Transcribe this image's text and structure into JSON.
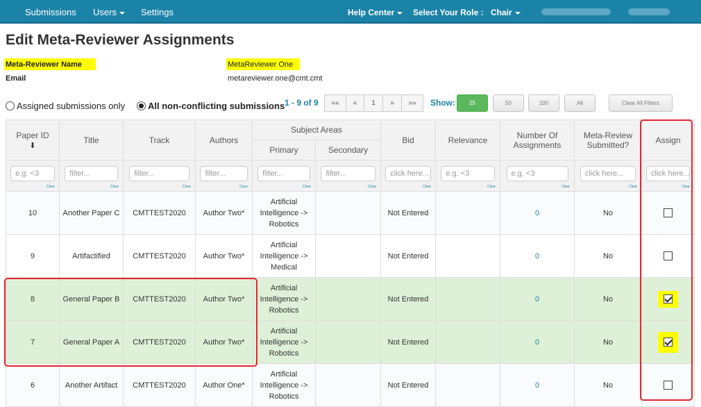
{
  "nav": {
    "submissions": "Submissions",
    "users": "Users",
    "settings": "Settings",
    "help_center": "Help Center",
    "role_label": "Select Your Role :",
    "role_value": "Chair"
  },
  "page": {
    "title": "Edit Meta-Reviewer Assignments",
    "name_label": "Meta-Reviewer Name",
    "name_value": "MetaReviewer One",
    "email_label": "Email",
    "email_value": "metareviewer.one@cmt.cmt"
  },
  "controls": {
    "radio_assigned": "Assigned submissions only",
    "radio_nonconflicting": "All non-conflicting submissions",
    "range": "1 - 9 of 9",
    "pager": [
      "««",
      "«",
      "1",
      "»",
      "»»"
    ],
    "show_label": "Show:",
    "show_options": [
      "25",
      "50",
      "100",
      "All"
    ],
    "clear_filters": "Clear All Filters"
  },
  "table": {
    "headers": {
      "paper_id": "Paper ID",
      "sort_arrow": "⬇",
      "title": "Title",
      "track": "Track",
      "authors": "Authors",
      "subject_areas": "Subject Areas",
      "primary": "Primary",
      "secondary": "Secondary",
      "bid": "Bid",
      "relevance": "Relevance",
      "num_assignments": "Number Of Assignments",
      "meta_review_submitted": "Meta-Review Submitted?",
      "assign": "Assign"
    },
    "filters": {
      "paper_id": "e.g. <3",
      "title": "filter...",
      "track": "filter...",
      "authors": "filter...",
      "primary": "filter...",
      "secondary": "filter...",
      "bid": "click here...",
      "relevance": "e.g. <3",
      "num_assignments": "e.g. <3",
      "meta_review_submitted": "click here...",
      "assign": "click here...",
      "clear": "Clear"
    },
    "rows": [
      {
        "paper_id": "10",
        "title": "Another Paper C",
        "track": "CMTTEST2020",
        "authors": "Author Two*",
        "primary": "Artificial Intelligence -> Robotics",
        "secondary": "",
        "bid": "Not Entered",
        "relevance": "",
        "num_assignments": "0",
        "submitted": "No",
        "assigned": false
      },
      {
        "paper_id": "9",
        "title": "Artifactified",
        "track": "CMTTEST2020",
        "authors": "Author Two*",
        "primary": "Artificial Intelligence -> Medical",
        "secondary": "",
        "bid": "Not Entered",
        "relevance": "",
        "num_assignments": "0",
        "submitted": "No",
        "assigned": false
      },
      {
        "paper_id": "8",
        "title": "General Paper B",
        "track": "CMTTEST2020",
        "authors": "Author Two*",
        "primary": "Artificial Intelligence -> Robotics",
        "secondary": "",
        "bid": "Not Entered",
        "relevance": "",
        "num_assignments": "0",
        "submitted": "No",
        "assigned": true
      },
      {
        "paper_id": "7",
        "title": "General Paper A",
        "track": "CMTTEST2020",
        "authors": "Author Two*",
        "primary": "Artificial Intelligence -> Robotics",
        "secondary": "",
        "bid": "Not Entered",
        "relevance": "",
        "num_assignments": "0",
        "submitted": "No",
        "assigned": true
      },
      {
        "paper_id": "6",
        "title": "Another Artifact",
        "track": "CMTTEST2020",
        "authors": "Author One*",
        "primary": "Artificial Intelligence -> Robotics",
        "secondary": "",
        "bid": "Not Entered",
        "relevance": "",
        "num_assignments": "0",
        "submitted": "No",
        "assigned": false
      }
    ]
  },
  "colors": {
    "nav_bg": "#1c83a8",
    "highlight": "#ffff00",
    "selected_row": "#dff0d8",
    "annotation_red": "#e3262e",
    "active_button": "#5cb85c"
  }
}
